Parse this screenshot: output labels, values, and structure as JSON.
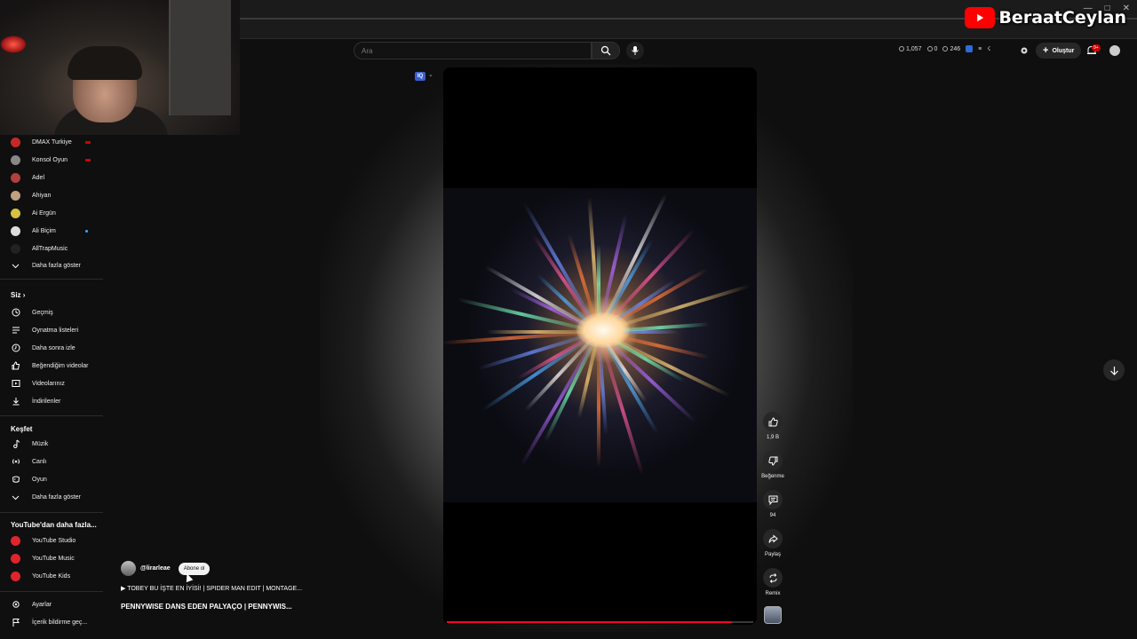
{
  "overlay": {
    "channel_name": "BeraatCeylan"
  },
  "search": {
    "placeholder": "Ara"
  },
  "topbar": {
    "stat1": "1,057",
    "stat2": "0",
    "stat3": "246",
    "create_label": "Oluştur",
    "notif_badge": "9+"
  },
  "sidebar": {
    "subscriptions": [
      {
        "label": "DMAX Turkiye",
        "live": true,
        "color": "#c62828"
      },
      {
        "label": "Konsol Oyun",
        "live": true,
        "color": "#888888"
      },
      {
        "label": "Adel",
        "live": false,
        "color": "#b04040"
      },
      {
        "label": "Ahiyan",
        "live": false,
        "color": "#c0a080"
      },
      {
        "label": "Ai Ergün",
        "live": false,
        "color": "#d8c040"
      },
      {
        "label": "Ali Biçim",
        "live": false,
        "new": true,
        "color": "#dddddd"
      },
      {
        "label": "AllTrapMusic",
        "live": false,
        "color": "#222222"
      }
    ],
    "show_more_subs": "Daha fazla göster",
    "you_heading": "Siz",
    "you_items": [
      "Geçmiş",
      "Oynatma listeleri",
      "Daha sonra izle",
      "Beğendiğim videolar",
      "Videolarınız",
      "İndirilenler"
    ],
    "explore_heading": "Keşfet",
    "explore_items": [
      "Müzik",
      "Canlı",
      "Oyun"
    ],
    "show_more_explore": "Daha fazla göster",
    "more_heading": "YouTube'dan daha fazla...",
    "more_items": [
      "YouTube Studio",
      "YouTube Music",
      "YouTube Kids"
    ],
    "settings": "Ayarlar",
    "report": "İçerik bildirme geç..."
  },
  "short": {
    "handle": "@lirarleae",
    "subscribe_label": "Abone ol",
    "related": "▶ TOBEY BU İŞTE EN İYİSİ! | SPIDER MAN EDIT | MONTAGE...",
    "title": "PENNYWISE DANS EDEN PALYAÇO | PENNYWIS...",
    "cc_label": "IQ",
    "progress": 0.93
  },
  "actions": {
    "likes": "1,9 B",
    "dislike": "Beğenme",
    "comments": "94",
    "share": "Paylaş",
    "remix": "Remix"
  },
  "colors": {
    "accent": "#ff0000",
    "progress": "#ff0033"
  }
}
